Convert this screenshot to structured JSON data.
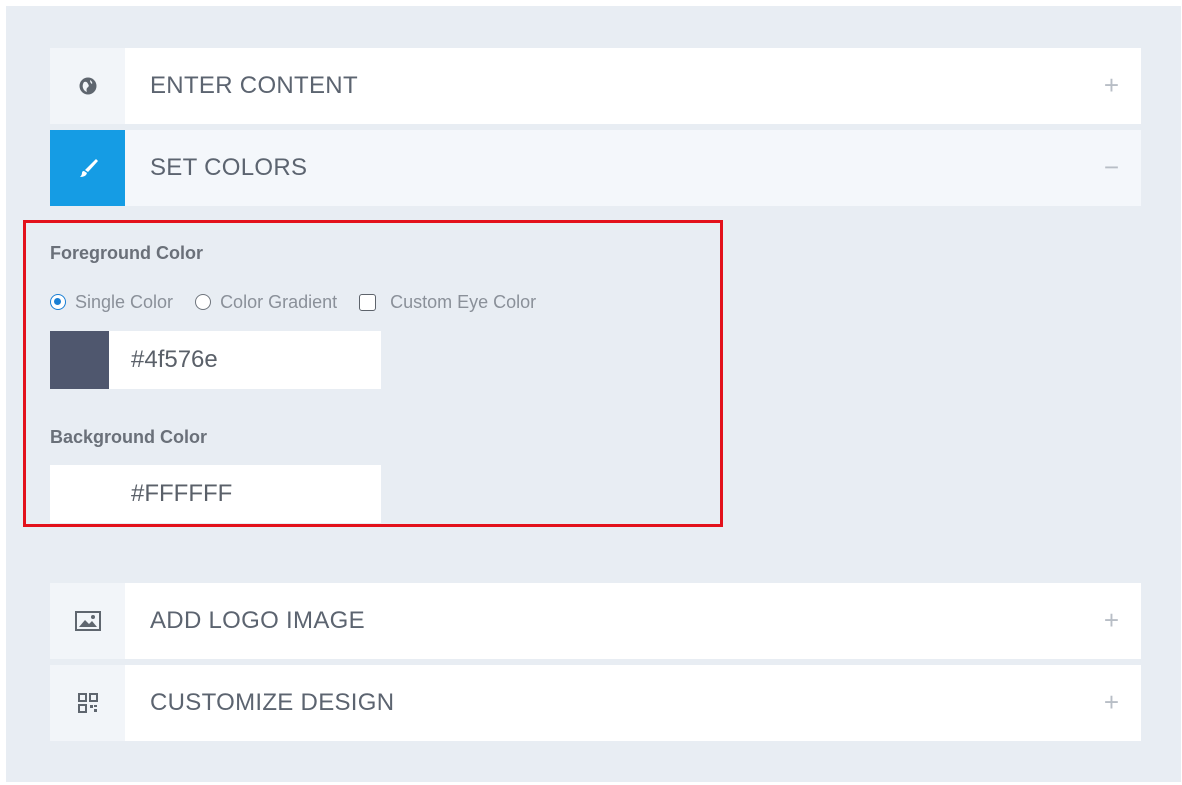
{
  "accordion": [
    {
      "title": "ENTER CONTENT",
      "toggle": "+",
      "icon": "globe-icon"
    },
    {
      "title": "SET COLORS",
      "toggle": "−",
      "icon": "brush-icon"
    },
    {
      "title": "ADD LOGO IMAGE",
      "toggle": "+",
      "icon": "image-icon"
    },
    {
      "title": "CUSTOMIZE DESIGN",
      "toggle": "+",
      "icon": "qr-code-icon"
    }
  ],
  "colors": {
    "foreground_label": "Foreground Color",
    "options": [
      "Single Color",
      "Color Gradient",
      "Custom Eye Color"
    ],
    "selected_option": "Single Color",
    "foreground_value": "#4f576e",
    "background_label": "Background Color",
    "background_value": "#FFFFFF"
  },
  "theme": {
    "accent": "#159ce4",
    "highlight": "#e3111b",
    "panel_bg": "#e8edf3"
  }
}
